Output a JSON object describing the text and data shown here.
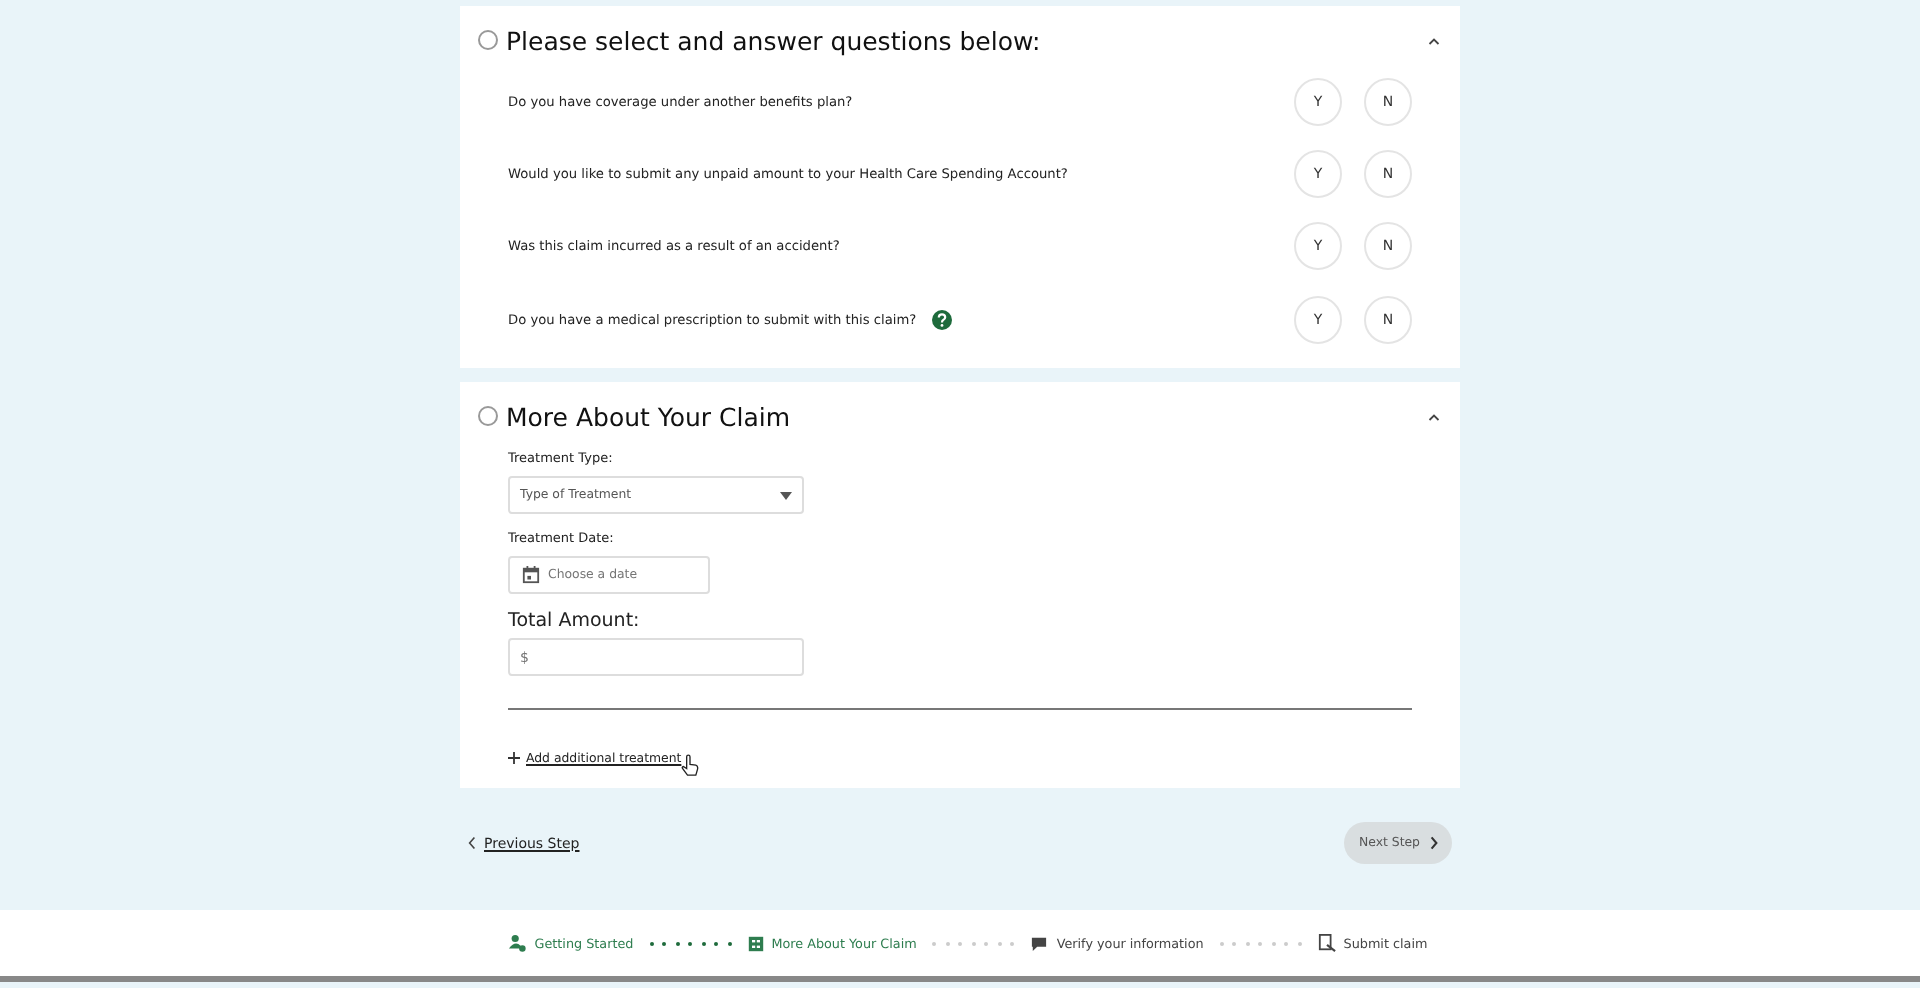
{
  "sections": [
    {
      "title": "Please select and answer questions below:",
      "complete": false,
      "expanded": true,
      "kind": "questions",
      "questions": [
        {
          "text": "Do you have coverage under another benefits plan?",
          "help": false,
          "options": [
            {
              "label": "Y",
              "selected": false
            },
            {
              "label": "N",
              "selected": false
            }
          ]
        },
        {
          "text": "Would you like to submit any unpaid amount to your Health Care Spending Account?",
          "help": false,
          "options": [
            {
              "label": "Y",
              "selected": false
            },
            {
              "label": "N",
              "selected": false
            }
          ]
        },
        {
          "text": "Was this claim incurred as a result of an accident?",
          "help": false,
          "options": [
            {
              "label": "Y",
              "selected": false
            },
            {
              "label": "N",
              "selected": false
            }
          ]
        },
        {
          "text": "Do you have a medical prescription to submit with this claim?",
          "help": true,
          "options": [
            {
              "label": "Y",
              "selected": false
            },
            {
              "label": "N",
              "selected": false
            }
          ]
        }
      ]
    },
    {
      "title": "More About Your Claim",
      "complete": false,
      "expanded": true,
      "kind": "claim",
      "treatment_type": {
        "label": "Treatment Type:",
        "placeholder": "Type of Treatment"
      },
      "treatment_date": {
        "label": "Treatment Date:",
        "placeholder": "Choose a date"
      },
      "total_amount": {
        "label": "Total Amount:",
        "placeholder": "$"
      },
      "add_link": "Add additional treatment"
    }
  ],
  "nav": {
    "previous": "Previous Step",
    "next": {
      "label": "Next Step",
      "disabled": true
    }
  },
  "steps": [
    {
      "label": "Getting Started",
      "complete": true,
      "current": false
    },
    {
      "label": "More About Your Claim",
      "complete": false,
      "current": true
    },
    {
      "label": "Verify your information",
      "complete": false,
      "current": false
    },
    {
      "label": "Submit claim",
      "complete": false,
      "current": false
    }
  ]
}
